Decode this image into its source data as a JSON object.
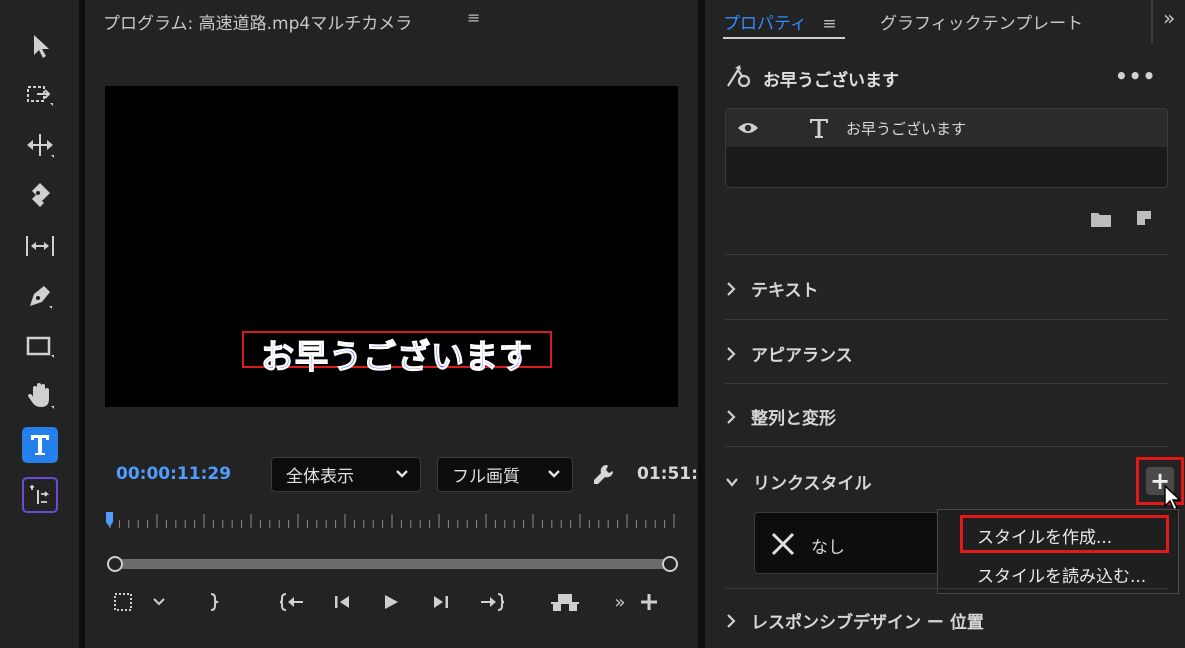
{
  "toolbar": {
    "tools": [
      "selection-tool",
      "track-select-forward-tool",
      "ripple-edit-tool",
      "razor-tool",
      "slip-tool",
      "pen-tool",
      "rectangle-tool",
      "hand-tool",
      "type-tool",
      "generative-extend-tool"
    ],
    "active": "type-tool",
    "active_color": "#2680eb"
  },
  "program_monitor": {
    "title": "プログラム: 高速道路.mp4マルチカメラ",
    "menu_icon": "≡",
    "caption": "お早うございます",
    "timecode": "00:00:11:29",
    "zoom_select": "全体表示",
    "quality_select": "フル画質",
    "end_time": "01:51:",
    "playhead_fraction": 0.0
  },
  "properties": {
    "tab_active": "プロパティ",
    "tab_menu_icon": "≡",
    "tab_other": "グラフィックテンプレート",
    "overflow": "»",
    "clip_name": "お早うございます",
    "more": "•••",
    "layer_name": "お早うございます",
    "sections": {
      "text": "テキスト",
      "appearance": "アピアランス",
      "align": "整列と変形",
      "linked_style": "リンクスタイル",
      "responsive": "レスポンシブデザイン ー 位置"
    },
    "style_none": "なし",
    "add_style": "+",
    "menu": {
      "create": "スタイルを作成...",
      "load": "スタイルを読み込む..."
    }
  },
  "colors": {
    "accent": "#4f9dff",
    "highlight": "#e11919",
    "caption_fill": "#2a3ef5"
  }
}
